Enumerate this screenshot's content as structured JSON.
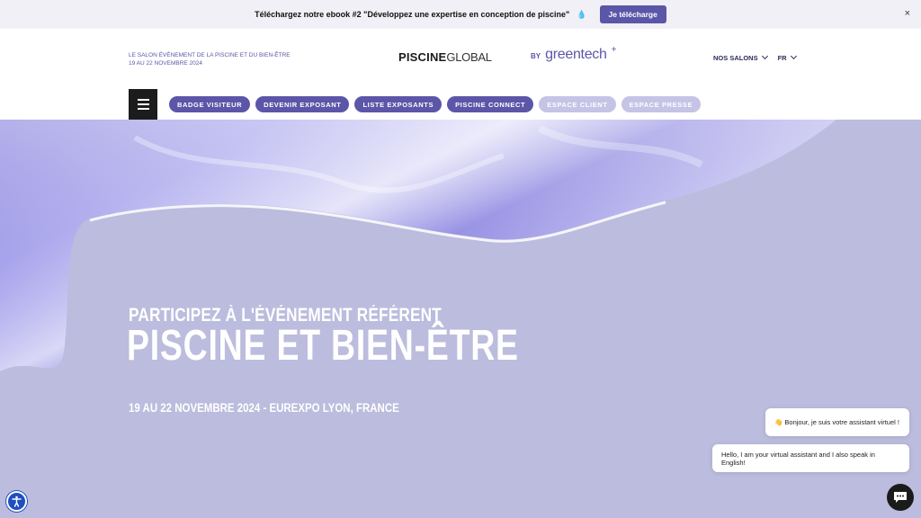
{
  "announcement": {
    "text": "Téléchargez notre ebook #2 \"Développez une expertise en conception de piscine\"",
    "icon": "water-drop-icon",
    "button_label": "Je télécharge",
    "close_label": "×"
  },
  "header": {
    "tagline_line1": "LE SALON ÉVÉNEMENT DE LA PISCINE ET DU BIEN-ÊTRE",
    "tagline_line2": "19 AU 22 NOVEMBRE 2024",
    "logo_bold": "PISCINE",
    "logo_light": "GLOBAL",
    "by_label": "BY",
    "partner_logo": "greentech",
    "partner_plus": "+",
    "nav_salons": "NOS SALONS",
    "nav_lang": "FR"
  },
  "pills": [
    {
      "label": "BADGE VISITEUR"
    },
    {
      "label": "DEVENIR EXPOSANT"
    },
    {
      "label": "LISTE EXPOSANTS"
    },
    {
      "label": "PISCINE CONNECT"
    },
    {
      "label": "ESPACE CLIENT"
    },
    {
      "label": "ESPACE PRESSE"
    }
  ],
  "hero": {
    "subtitle": "PARTICIPEZ À L'ÉVÉNEMENT RÉFÉRENT",
    "title": "PISCINE ET BIEN-ÊTRE",
    "date": "19 AU 22 NOVEMBRE 2024 - EUREXPO LYON, FRANCE"
  },
  "chat": {
    "message_fr": "👋 Bonjour, je suis votre assistant virtuel !",
    "message_en": "Hello, I am your virtual assistant and I also speak in English!"
  },
  "colors": {
    "accent": "#5b56a8",
    "pill_light": "#c5c3e6",
    "hero_bg": "#bcbcde"
  }
}
